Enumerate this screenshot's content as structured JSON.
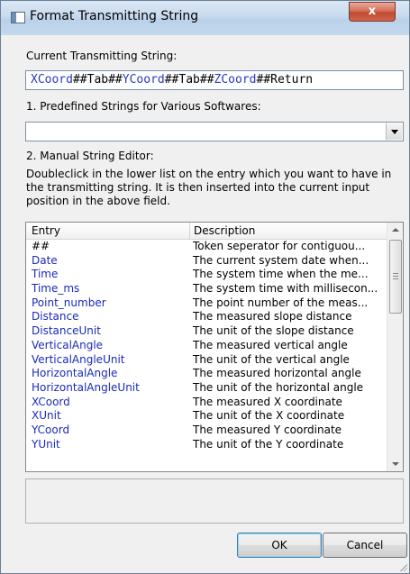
{
  "window": {
    "title": "Format Transmitting String",
    "close_glyph": "x"
  },
  "current": {
    "label": "Current Transmitting String:",
    "tokens": [
      {
        "text": "XCoord",
        "kind": "field"
      },
      {
        "text": "##",
        "kind": "sep"
      },
      {
        "text": "Tab",
        "kind": "sep"
      },
      {
        "text": "##",
        "kind": "sep"
      },
      {
        "text": "YCoord",
        "kind": "field"
      },
      {
        "text": "##",
        "kind": "sep"
      },
      {
        "text": "Tab",
        "kind": "sep"
      },
      {
        "text": "##",
        "kind": "sep"
      },
      {
        "text": "ZCoord",
        "kind": "field"
      },
      {
        "text": "##",
        "kind": "sep"
      },
      {
        "text": "Return",
        "kind": "sep"
      }
    ]
  },
  "predefined": {
    "label": "1. Predefined Strings for Various Softwares:",
    "selected": ""
  },
  "manual": {
    "label": "2. Manual String Editor:",
    "help": "Doubleclick in the lower list on the entry which you want to have in the transmitting string. It is then inserted into the current input position in the above field."
  },
  "list": {
    "columns": [
      "Entry",
      "Description"
    ],
    "rows": [
      {
        "entry": "##",
        "desc": "Token seperator for contiguou...",
        "plain": true
      },
      {
        "entry": "Date",
        "desc": "The current system date when..."
      },
      {
        "entry": "Time",
        "desc": "The system time when the me..."
      },
      {
        "entry": "Time_ms",
        "desc": "The system time with millisecon..."
      },
      {
        "entry": "Point_number",
        "desc": "The point number of the meas..."
      },
      {
        "entry": "Distance",
        "desc": "The measured slope distance"
      },
      {
        "entry": "DistanceUnit",
        "desc": "The unit of the slope distance"
      },
      {
        "entry": "VerticalAngle",
        "desc": "The measured vertical angle"
      },
      {
        "entry": "VerticalAngleUnit",
        "desc": "The unit of the vertical angle"
      },
      {
        "entry": "HorizontalAngle",
        "desc": "The measured horizontal angle"
      },
      {
        "entry": "HorizontalAngleUnit",
        "desc": "The unit of the horizontal angle"
      },
      {
        "entry": "XCoord",
        "desc": "The measured X coordinate"
      },
      {
        "entry": "XUnit",
        "desc": "The unit of the X coordinate"
      },
      {
        "entry": "YCoord",
        "desc": "The measured Y coordinate"
      },
      {
        "entry": "YUnit",
        "desc": "The unit of the Y coordinate"
      }
    ]
  },
  "buttons": {
    "ok": "OK",
    "cancel": "Cancel"
  },
  "colors": {
    "token_field": "#2a36c4",
    "entry_text": "#1a2bb8",
    "title_bar": "#c8dbee",
    "close_button": "#c04a30"
  }
}
